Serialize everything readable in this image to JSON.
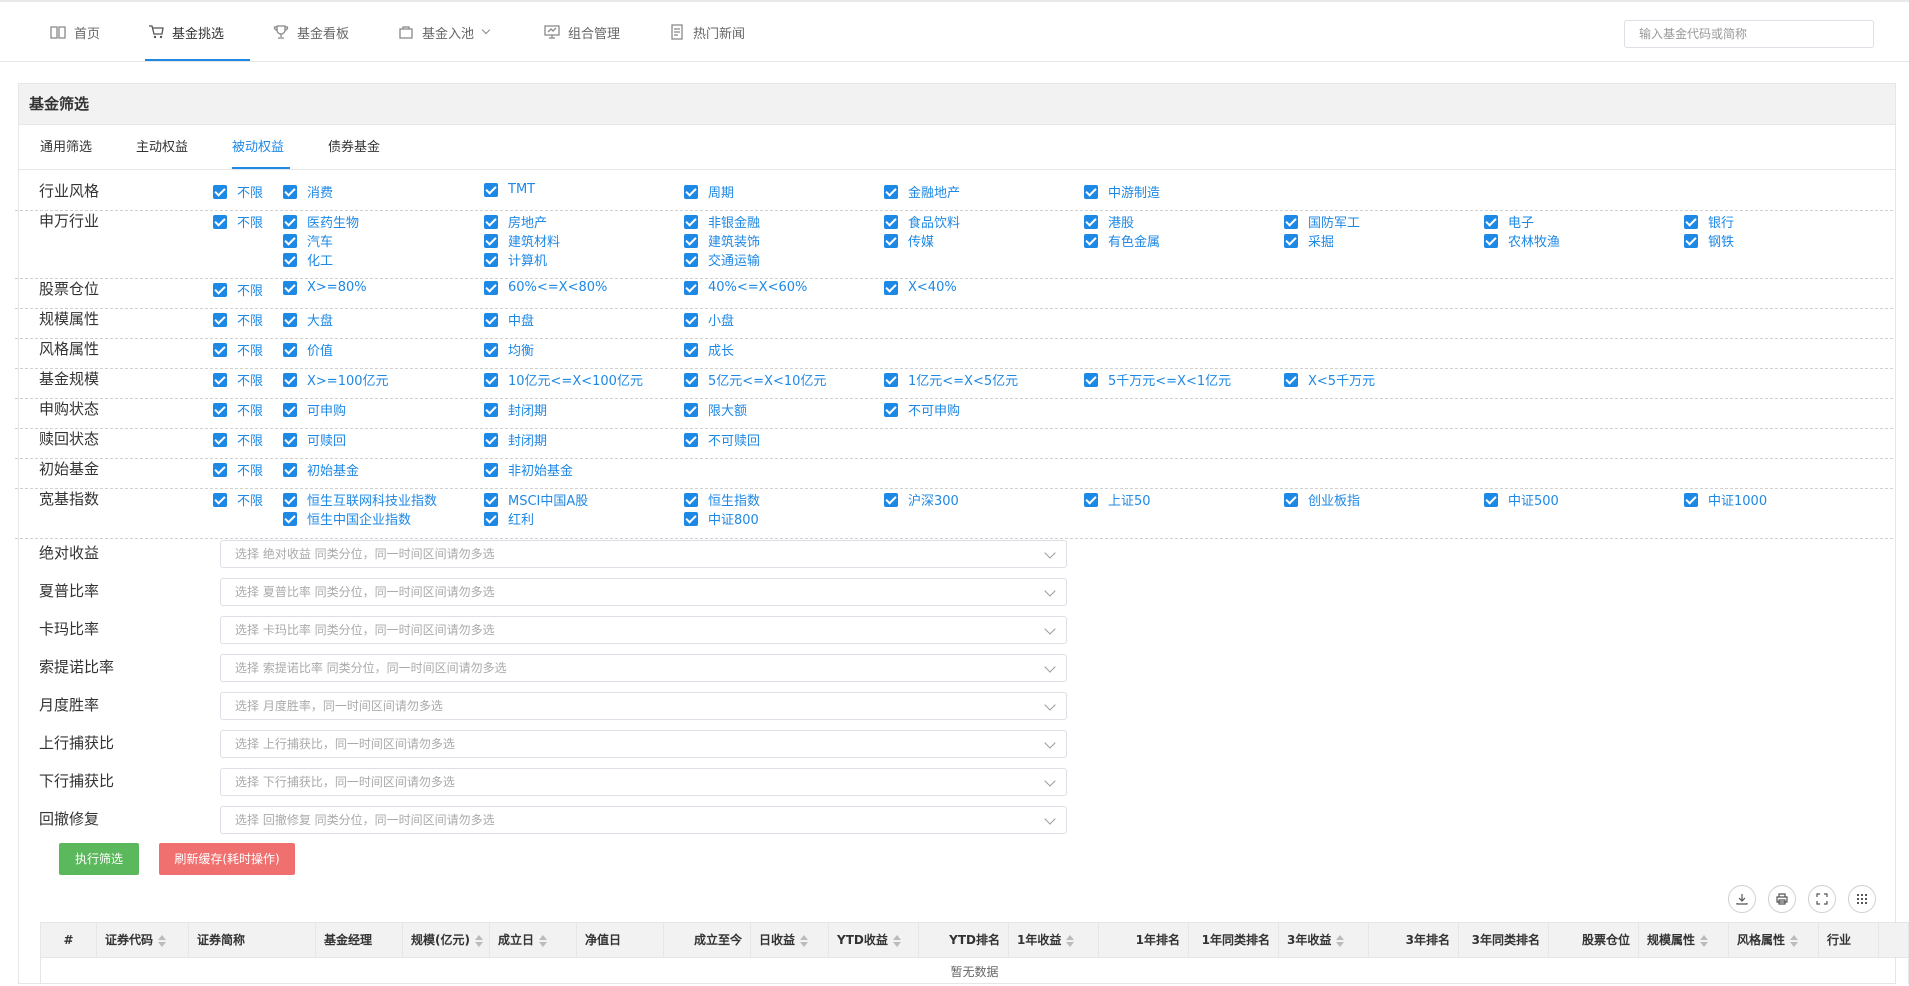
{
  "nav": {
    "items": [
      {
        "label": "首页",
        "icon": "book-icon"
      },
      {
        "label": "基金挑选",
        "icon": "cart-icon"
      },
      {
        "label": "基金看板",
        "icon": "trophy-icon"
      },
      {
        "label": "基金入池",
        "icon": "bag-icon"
      },
      {
        "label": "组合管理",
        "icon": "chart-board-icon"
      },
      {
        "label": "热门新闻",
        "icon": "news-icon"
      }
    ],
    "search_placeholder": "输入基金代码或简称"
  },
  "panel": {
    "title": "基金筛选",
    "tabs": [
      "通用筛选",
      "主动权益",
      "被动权益",
      "债券基金"
    ],
    "active_tab": "被动权益"
  },
  "filters": [
    {
      "label": "行业风格",
      "options": [
        "不限",
        "消费",
        "TMT",
        "周期",
        "金融地产",
        "中游制造"
      ]
    },
    {
      "label": "申万行业",
      "options": [
        "不限",
        "医药生物",
        "房地产",
        "非银金融",
        "食品饮料",
        "港股",
        "国防军工",
        "电子",
        "银行",
        "汽车",
        "建筑材料",
        "建筑装饰",
        "传媒",
        "有色金属",
        "采掘",
        "农林牧渔",
        "钢铁",
        "化工",
        "计算机",
        "交通运输"
      ]
    },
    {
      "label": "股票仓位",
      "options": [
        "不限",
        "X>=80%",
        "60%<=X<80%",
        "40%<=X<60%",
        "X<40%"
      ]
    },
    {
      "label": "规模属性",
      "options": [
        "不限",
        "大盘",
        "中盘",
        "小盘"
      ]
    },
    {
      "label": "风格属性",
      "options": [
        "不限",
        "价值",
        "均衡",
        "成长"
      ]
    },
    {
      "label": "基金规模",
      "options": [
        "不限",
        "X>=100亿元",
        "10亿元<=X<100亿元",
        "5亿元<=X<10亿元",
        "1亿元<=X<5亿元",
        "5千万元<=X<1亿元",
        "X<5千万元"
      ]
    },
    {
      "label": "申购状态",
      "options": [
        "不限",
        "可申购",
        "封闭期",
        "限大额",
        "不可申购"
      ]
    },
    {
      "label": "赎回状态",
      "options": [
        "不限",
        "可赎回",
        "封闭期",
        "不可赎回"
      ]
    },
    {
      "label": "初始基金",
      "options": [
        "不限",
        "初始基金",
        "非初始基金"
      ]
    },
    {
      "label": "宽基指数",
      "options": [
        "不限",
        "恒生互联网科技业指数",
        "MSCI中国A股",
        "恒生指数",
        "沪深300",
        "上证50",
        "创业板指",
        "中证500",
        "中证1000",
        "恒生中国企业指数",
        "红利",
        "中证800"
      ]
    }
  ],
  "metrics": [
    {
      "label": "绝对收益",
      "placeholder": "选择 绝对收益 同类分位，同一时间区间请勿多选"
    },
    {
      "label": "夏普比率",
      "placeholder": "选择 夏普比率 同类分位，同一时间区间请勿多选"
    },
    {
      "label": "卡玛比率",
      "placeholder": "选择 卡玛比率 同类分位，同一时间区间请勿多选"
    },
    {
      "label": "索提诺比率",
      "placeholder": "选择 索提诺比率 同类分位，同一时间区间请勿多选"
    },
    {
      "label": "月度胜率",
      "placeholder": "选择 月度胜率，同一时间区间请勿多选"
    },
    {
      "label": "上行捕获比",
      "placeholder": "选择 上行捕获比，同一时间区间请勿多选"
    },
    {
      "label": "下行捕获比",
      "placeholder": "选择 下行捕获比，同一时间区间请勿多选"
    },
    {
      "label": "回撤修复",
      "placeholder": "选择 回撤修复 同类分位，同一时间区间请勿多选"
    }
  ],
  "buttons": {
    "run": "执行筛选",
    "refresh": "刷新缓存(耗时操作)"
  },
  "colors": {
    "accent": "#1e88e5",
    "run": "#5cb85c",
    "refresh": "#f07070"
  },
  "table": {
    "columns": [
      "#",
      "证券代码",
      "证券简称",
      "基金经理",
      "规模(亿元)",
      "成立日",
      "净值日",
      "成立至今",
      "日收益",
      "YTD收益",
      "YTD排名",
      "1年收益",
      "1年排名",
      "1年同类排名",
      "3年收益",
      "3年排名",
      "3年同类排名",
      "股票仓位",
      "规模属性",
      "风格属性",
      "行业"
    ],
    "sortable": [
      false,
      true,
      false,
      false,
      true,
      true,
      false,
      false,
      true,
      true,
      false,
      true,
      false,
      false,
      true,
      false,
      false,
      false,
      true,
      true,
      false
    ],
    "empty_text": "暂无数据"
  }
}
